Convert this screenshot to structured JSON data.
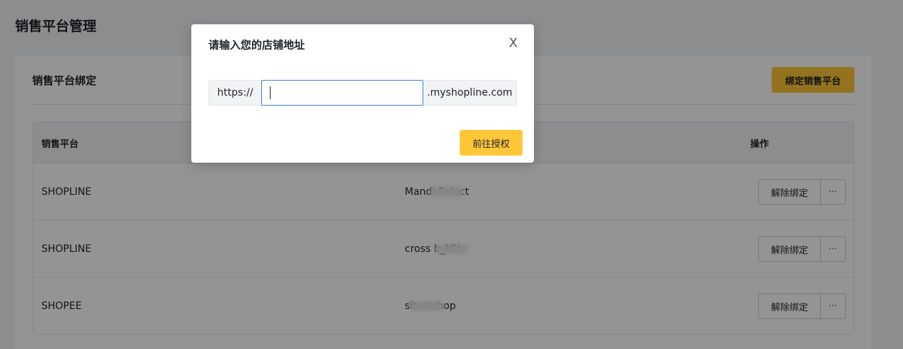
{
  "page": {
    "title": "销售平台管理"
  },
  "card": {
    "title": "销售平台绑定",
    "bind_button": "绑定销售平台"
  },
  "table": {
    "headers": {
      "platform": "销售平台",
      "actions": "操作"
    },
    "rows": [
      {
        "platform": "SHOPLINE",
        "store": "Mandi Select",
        "unbind": "解除绑定",
        "more": "···"
      },
      {
        "platform": "SHOPLINE",
        "store": "cross b_MY",
        "unbind": "解除绑定",
        "more": "···"
      },
      {
        "platform": "SHOPEE",
        "store": "sitestshop",
        "unbind": "解除绑定",
        "more": "···"
      }
    ]
  },
  "modal": {
    "title": "请输入您的店铺地址",
    "close": "X",
    "prefix": "https://",
    "input_value": "",
    "suffix": ".myshopline.com",
    "submit": "前往授权"
  },
  "colors": {
    "accent": "#ffc738",
    "focus": "#3c7ee6",
    "overlay": "rgba(0,0,0,0.42)"
  }
}
